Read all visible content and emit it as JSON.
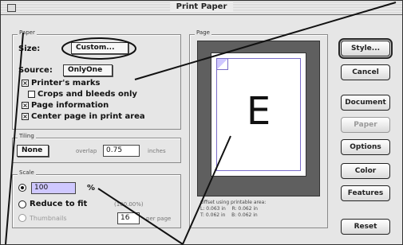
{
  "window": {
    "title": "Print Paper"
  },
  "paper_group": {
    "legend": "Paper",
    "size_label": "Size:",
    "size_value": "Custom...",
    "source_label": "Source:",
    "source_value": "OnlyOne",
    "printers_marks": {
      "label": "Printer's marks",
      "checked": true
    },
    "crops_bleeds": {
      "label": "Crops and bleeds only",
      "checked": false
    },
    "page_information": {
      "label": "Page information",
      "checked": true
    },
    "center_page": {
      "label": "Center page in print area",
      "checked": true
    }
  },
  "tiling_group": {
    "legend": "Tiling",
    "mode_value": "None",
    "overlap_label": "overlap",
    "overlap_value": "0.75",
    "units": "inches"
  },
  "scale_group": {
    "legend": "Scale",
    "percent_value": "100",
    "percent_symbol": "%",
    "reduce_label": "Reduce to fit",
    "reduce_extra": "(100.00%)",
    "thumbnails_label": "Thumbnails",
    "thumbnails_value": "16",
    "per_page_label": "per page"
  },
  "preview_group": {
    "legend": "Page",
    "letter": "E",
    "margins_title": "Offset using printable area:",
    "margin_left": "L: 0.063 in",
    "margin_right": "R: 0.062 in",
    "margin_top": "T: 0.062 in",
    "margin_bottom": "B: 0.062 in"
  },
  "buttons": {
    "style": "Style...",
    "cancel": "Cancel",
    "document": "Document",
    "paper": "Paper",
    "options": "Options",
    "color": "Color",
    "features": "Features",
    "reset": "Reset"
  },
  "colors": {
    "printable_border": "#7a6cc8",
    "preview_background": "#5f5f5f",
    "selection_highlight": "#cfc8ff"
  },
  "icons": {
    "close": "close-box-icon",
    "checkbox_checked": "checkmark-icon"
  }
}
